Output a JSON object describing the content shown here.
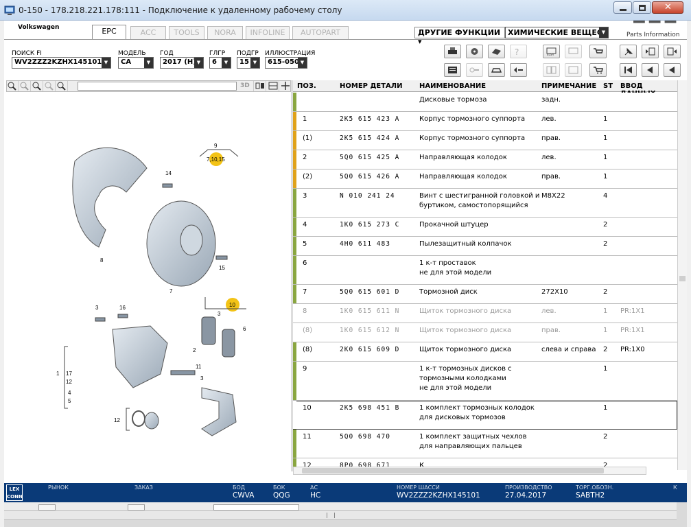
{
  "window": {
    "title": "0-150 - 178.218.221.178:111 - Подключение к удаленному рабочему столу"
  },
  "brand": "Volkswagen",
  "tabs": [
    {
      "label": "EPC"
    },
    {
      "label": "ACC"
    },
    {
      "label": "TOOLS"
    },
    {
      "label": "NORA"
    },
    {
      "label": "INFOLINE"
    },
    {
      "label": "AUTOPART"
    }
  ],
  "functions": {
    "label": "ДРУГИЕ ФУНКЦИИ ▾",
    "selected": "ХИМИЧЕСКИЕ ВЕЩЕСТВА"
  },
  "logo": {
    "text": "Parts Information"
  },
  "filters": {
    "search": {
      "label": "ПОИСК FI",
      "value": "WV2ZZZ2KZHX145101"
    },
    "model": {
      "label": "МОДЕЛЬ",
      "value": "CA"
    },
    "year": {
      "label": "ГОД",
      "value": "2017 (H)"
    },
    "mg": {
      "label": "ГЛГР",
      "value": "6"
    },
    "sg": {
      "label": "ПОДГР",
      "value": "15"
    },
    "illus": {
      "label": "ИЛЛЮСТРАЦИЯ",
      "value": "615-050"
    }
  },
  "illus_toolbar": {
    "btn3d": "3D"
  },
  "illustration": {
    "labels": [
      "9",
      "7,10,15",
      "14",
      "8",
      "15",
      "7",
      "10",
      "3",
      "16",
      "3",
      "6",
      "2",
      "11",
      "1",
      "17",
      "12",
      "4",
      "5",
      "12",
      "3"
    ]
  },
  "grid": {
    "headers": {
      "pos": "ПОЗ.",
      "part": "НОМЕР ДЕТАЛИ",
      "name": "НАИМЕНОВАНИЕ",
      "note": "ПРИМЕЧАНИЕ",
      "st": "ST",
      "input": "ВВОД ДАННЫХ"
    },
    "rows": [
      {
        "pos": "",
        "part": "",
        "name": "Дисковые тормоза",
        "name2": "",
        "note": "задн.",
        "st": "",
        "input": "",
        "bar": "#8aa640",
        "gray": false,
        "sel": false
      },
      {
        "pos": "1",
        "part": "2K5  615  423  A",
        "name": "Корпус тормозного суппорта",
        "name2": "",
        "note": "лев.",
        "st": "1",
        "input": "",
        "bar": "#e0a21a",
        "gray": false,
        "sel": false
      },
      {
        "pos": "(1)",
        "part": "2K5  615  424  A",
        "name": "Корпус тормозного суппорта",
        "name2": "",
        "note": "прав.",
        "st": "1",
        "input": "",
        "bar": "#e0a21a",
        "gray": false,
        "sel": false
      },
      {
        "pos": "2",
        "part": "5Q0  615  425  A",
        "name": "Направляющая колодок",
        "name2": "",
        "note": "лев.",
        "st": "1",
        "input": "",
        "bar": "#e0a21a",
        "gray": false,
        "sel": false
      },
      {
        "pos": "(2)",
        "part": "5Q0  615  426  A",
        "name": "Направляющая колодок",
        "name2": "",
        "note": "прав.",
        "st": "1",
        "input": "",
        "bar": "#e0a21a",
        "gray": false,
        "sel": false
      },
      {
        "pos": "3",
        "part": "N    010  241  24",
        "name": "Винт с шестигранной головкой и",
        "name2": "буртиком, самостопорящийся",
        "note": "M8X22",
        "st": "4",
        "input": "",
        "bar": "#8aa640",
        "gray": false,
        "sel": false
      },
      {
        "pos": "4",
        "part": "1K0  615  273  C",
        "name": "Прокачной штуцер",
        "name2": "",
        "note": "",
        "st": "2",
        "input": "",
        "bar": "#8aa640",
        "gray": false,
        "sel": false
      },
      {
        "pos": "5",
        "part": "4H0  611  483",
        "name": "Пылезащитный колпачок",
        "name2": "",
        "note": "",
        "st": "2",
        "input": "",
        "bar": "#8aa640",
        "gray": false,
        "sel": false
      },
      {
        "pos": "6",
        "part": "",
        "name": "1 к-т проставок",
        "name2": "не для этой модели",
        "note": "",
        "st": "",
        "input": "",
        "bar": "#8aa640",
        "gray": false,
        "sel": false
      },
      {
        "pos": "7",
        "part": "5Q0  615  601  D",
        "name": "Тормозной диск",
        "name2": "",
        "note": "272X10",
        "st": "2",
        "input": "",
        "bar": "#8aa640",
        "gray": false,
        "sel": false
      },
      {
        "pos": "8",
        "part": "1K0  615  611  N",
        "name": "Щиток тормозного диска",
        "name2": "",
        "note": "лев.",
        "st": "1",
        "input": "PR:1X1",
        "bar": "#ffffff",
        "gray": true,
        "sel": false
      },
      {
        "pos": "(8)",
        "part": "1K0  615  612  N",
        "name": "Щиток тормозного диска",
        "name2": "",
        "note": "прав.",
        "st": "1",
        "input": "PR:1X1",
        "bar": "#ffffff",
        "gray": true,
        "sel": false
      },
      {
        "pos": "(8)",
        "part": "2K0  615  609  D",
        "name": "Щиток тормозного диска",
        "name2": "",
        "note": "слева и справа",
        "st": "2",
        "input": "PR:1X0",
        "bar": "#8aa640",
        "gray": false,
        "sel": false
      },
      {
        "pos": "9",
        "part": "",
        "name": "1 к-т тормозных дисков с",
        "name2": "тормозными колодками",
        "name3": "не для этой модели",
        "note": "",
        "st": "1",
        "input": "",
        "bar": "#8aa640",
        "gray": false,
        "sel": false
      },
      {
        "pos": "10",
        "part": "2K5  698  451  B",
        "name": "1 комплект тормозных колодок",
        "name2": "для дисковых тормозов",
        "note": "",
        "st": "1",
        "input": "",
        "bar": "#ffffff",
        "gray": false,
        "sel": true
      },
      {
        "pos": "11",
        "part": "5Q0  698  470",
        "name": "1 комплект защитных чехлов",
        "name2": "для направляющих пальцев",
        "note": "",
        "st": "2",
        "input": "",
        "bar": "#8aa640",
        "gray": false,
        "sel": false
      },
      {
        "pos": "12",
        "part": "8P0  698  671",
        "name": "К",
        "name2": "",
        "note": "",
        "st": "2",
        "input": "",
        "bar": "#8aa640",
        "gray": false,
        "sel": false
      }
    ]
  },
  "status": {
    "market_label": "РЫНОК",
    "order_label": "ЗАКАЗ",
    "bod_label": "БОД",
    "bod": "CWVA",
    "bok_label": "БОК",
    "bok": "QQG",
    "ac_label": "АС",
    "ac": "HC",
    "chassis_label": "НОМЕР ШАССИ",
    "chassis": "WV2ZZZ2KZHX145101",
    "prod_label": "ПРОИЗВОДСТВО",
    "prod": "27.04.2017",
    "trade_label": "ТОРГ.ОБОЗН.",
    "trade": "SABTH2",
    "k": "К",
    "lex": "LEX CONN"
  },
  "colors": {
    "accent": "#e0a21a",
    "green": "#8aa640",
    "status_bg": "#0a3a78",
    "callout": "#f3c316"
  }
}
